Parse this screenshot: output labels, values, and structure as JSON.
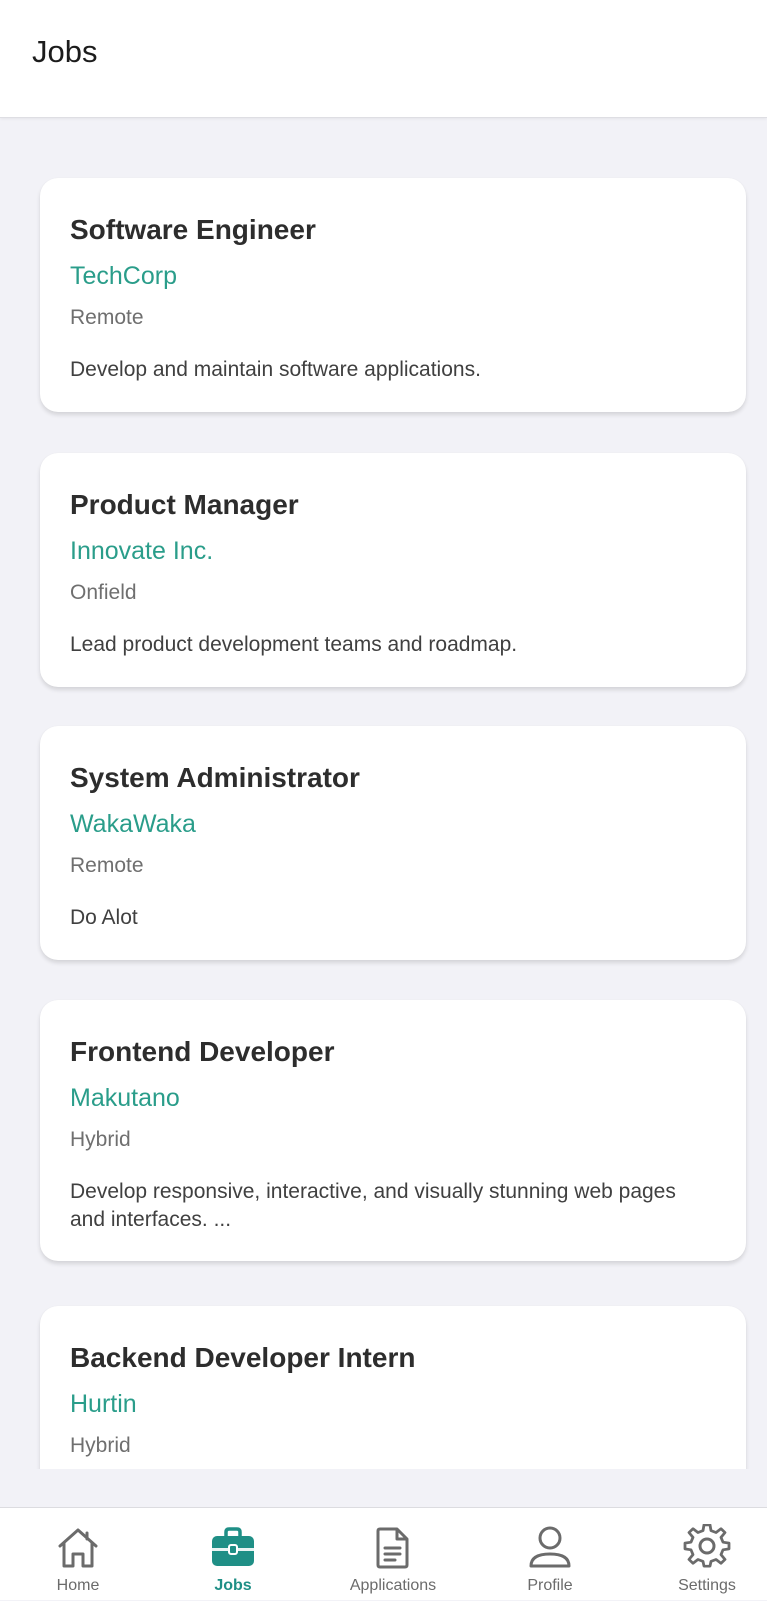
{
  "header": {
    "title": "Jobs"
  },
  "colors": {
    "accent": "#2a9d8a",
    "tab_active": "#1f8f86",
    "background": "#f2f2f7"
  },
  "jobs": [
    {
      "title": "Software Engineer",
      "company": "TechCorp",
      "location": "Remote",
      "description": "Develop and maintain software applications."
    },
    {
      "title": "Product Manager",
      "company": "Innovate Inc.",
      "location": "Onfield",
      "description": "Lead product development teams and roadmap."
    },
    {
      "title": "System Administrator",
      "company": "WakaWaka",
      "location": "Remote",
      "description": "Do Alot"
    },
    {
      "title": "Frontend Developer",
      "company": "Makutano",
      "location": "Hybrid",
      "description": "Develop responsive, interactive, and visually stunning web pages and interfaces. ..."
    },
    {
      "title": "Backend Developer Intern",
      "company": "Hurtin",
      "location": "Hybrid",
      "description": ""
    }
  ],
  "tabs": [
    {
      "label": "Home",
      "icon": "home-icon",
      "active": false
    },
    {
      "label": "Jobs",
      "icon": "briefcase-icon",
      "active": true
    },
    {
      "label": "Applications",
      "icon": "document-icon",
      "active": false
    },
    {
      "label": "Profile",
      "icon": "person-icon",
      "active": false
    },
    {
      "label": "Settings",
      "icon": "gear-icon",
      "active": false
    }
  ]
}
